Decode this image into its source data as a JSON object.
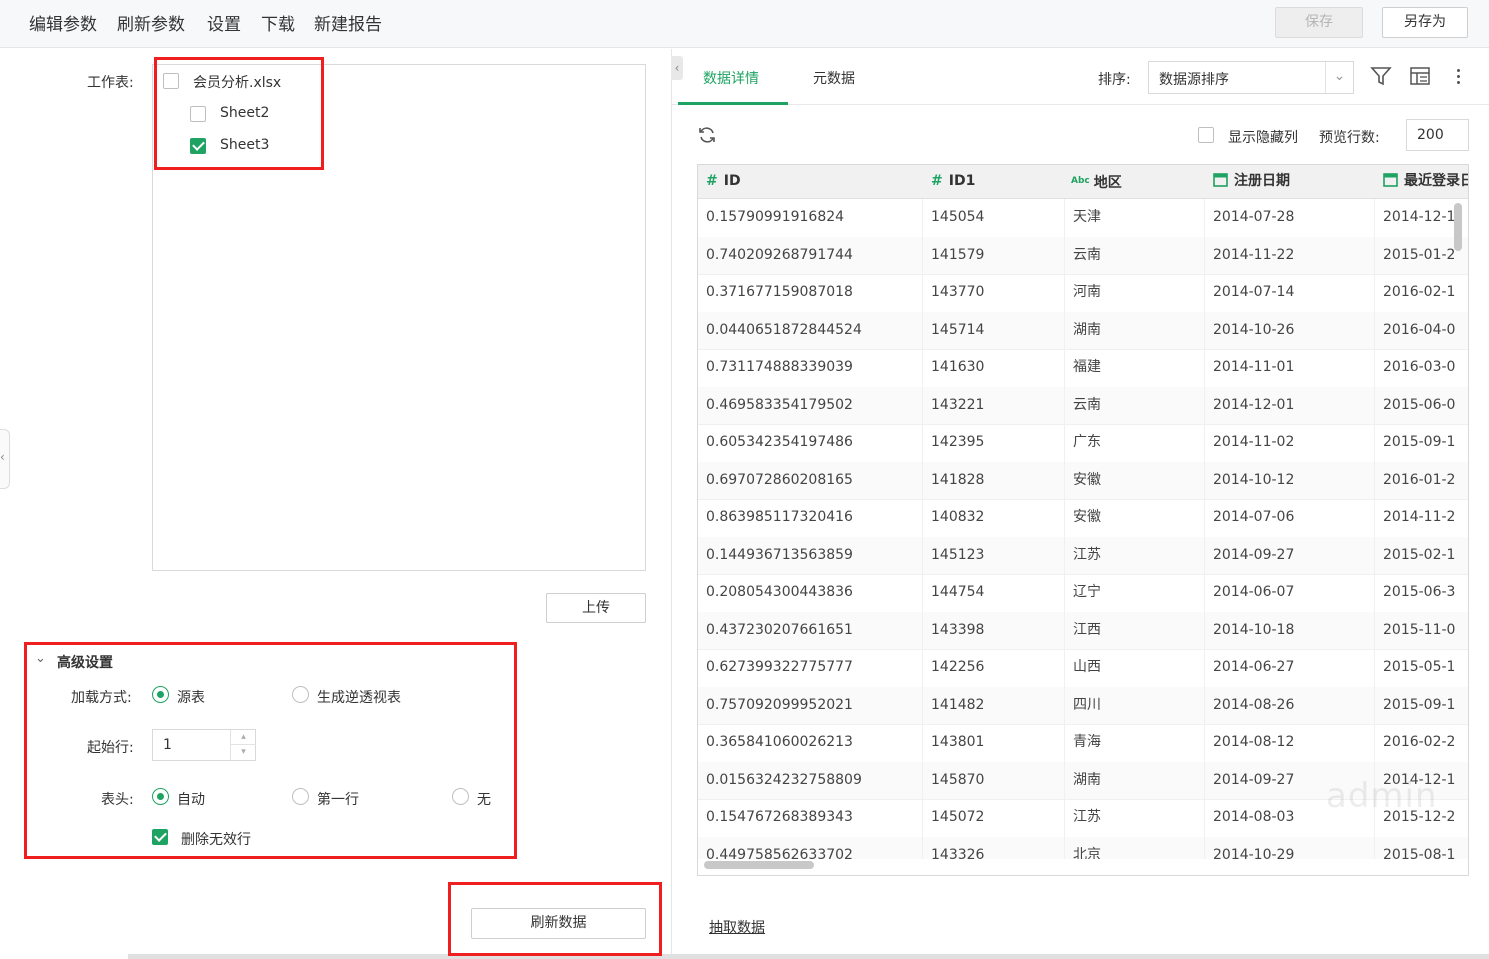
{
  "menu": [
    "编辑参数",
    "刷新参数",
    "设置",
    "下载",
    "新建报告"
  ],
  "toolbar": {
    "save": "保存",
    "save_as": "另存为"
  },
  "left": {
    "worksheet_label": "工作表:",
    "file_name": "会员分析.xlsx",
    "sheets": [
      {
        "name": "Sheet2",
        "checked": false
      },
      {
        "name": "Sheet3",
        "checked": true
      }
    ],
    "upload": "上传",
    "advanced": {
      "title": "高级设置",
      "load_mode_label": "加载方式:",
      "load_options": [
        "源表",
        "生成逆透视表"
      ],
      "start_row_label": "起始行:",
      "start_row_value": "1",
      "header_label": "表头:",
      "header_options": [
        "自动",
        "第一行",
        "无"
      ],
      "delete_invalid": "删除无效行"
    },
    "refresh_data": "刷新数据"
  },
  "right": {
    "tabs": [
      "数据详情",
      "元数据"
    ],
    "sort_label": "排序:",
    "sort_value": "数据源排序",
    "show_hidden": "显示隐藏列",
    "preview_rows_label": "预览行数:",
    "preview_rows_value": "200",
    "watermark": "admin",
    "extract": "抽取数据",
    "columns": [
      {
        "type": "#",
        "name": "ID"
      },
      {
        "type": "#",
        "name": "ID1"
      },
      {
        "type": "Abc",
        "name": "地区"
      },
      {
        "type": "date",
        "name": "注册日期"
      },
      {
        "type": "date",
        "name": "最近登录日"
      }
    ],
    "rows": [
      [
        "0.15790991916824",
        "145054",
        "天津",
        "2014-07-28",
        "2014-12-1"
      ],
      [
        "0.740209268791744",
        "141579",
        "云南",
        "2014-11-22",
        "2015-01-2"
      ],
      [
        "0.371677159087018",
        "143770",
        "河南",
        "2014-07-14",
        "2016-02-1"
      ],
      [
        "0.0440651872844524",
        "145714",
        "湖南",
        "2014-10-26",
        "2016-04-0"
      ],
      [
        "0.731174888339039",
        "141630",
        "福建",
        "2014-11-01",
        "2016-03-0"
      ],
      [
        "0.469583354179502",
        "143221",
        "云南",
        "2014-12-01",
        "2015-06-0"
      ],
      [
        "0.605342354197486",
        "142395",
        "广东",
        "2014-11-02",
        "2015-09-1"
      ],
      [
        "0.697072860208165",
        "141828",
        "安徽",
        "2014-10-12",
        "2016-01-2"
      ],
      [
        "0.863985117320416",
        "140832",
        "安徽",
        "2014-07-06",
        "2014-11-2"
      ],
      [
        "0.144936713563859",
        "145123",
        "江苏",
        "2014-09-27",
        "2015-02-1"
      ],
      [
        "0.208054300443836",
        "144754",
        "辽宁",
        "2014-06-07",
        "2015-06-3"
      ],
      [
        "0.437230207661651",
        "143398",
        "江西",
        "2014-10-18",
        "2015-11-0"
      ],
      [
        "0.627399322775777",
        "142256",
        "山西",
        "2014-06-27",
        "2015-05-1"
      ],
      [
        "0.757092099952021",
        "141482",
        "四川",
        "2014-08-26",
        "2015-09-1"
      ],
      [
        "0.365841060026213",
        "143801",
        "青海",
        "2014-08-12",
        "2016-02-2"
      ],
      [
        "0.0156324232758809",
        "145870",
        "湖南",
        "2014-09-27",
        "2014-12-1"
      ],
      [
        "0.154767268389343",
        "145072",
        "江苏",
        "2014-08-03",
        "2015-12-2"
      ],
      [
        "0.449758562633702",
        "143326",
        "北京",
        "2014-10-29",
        "2015-08-1"
      ]
    ]
  },
  "colors": {
    "accent": "#1ea362",
    "highlight": "#f01f1f"
  }
}
